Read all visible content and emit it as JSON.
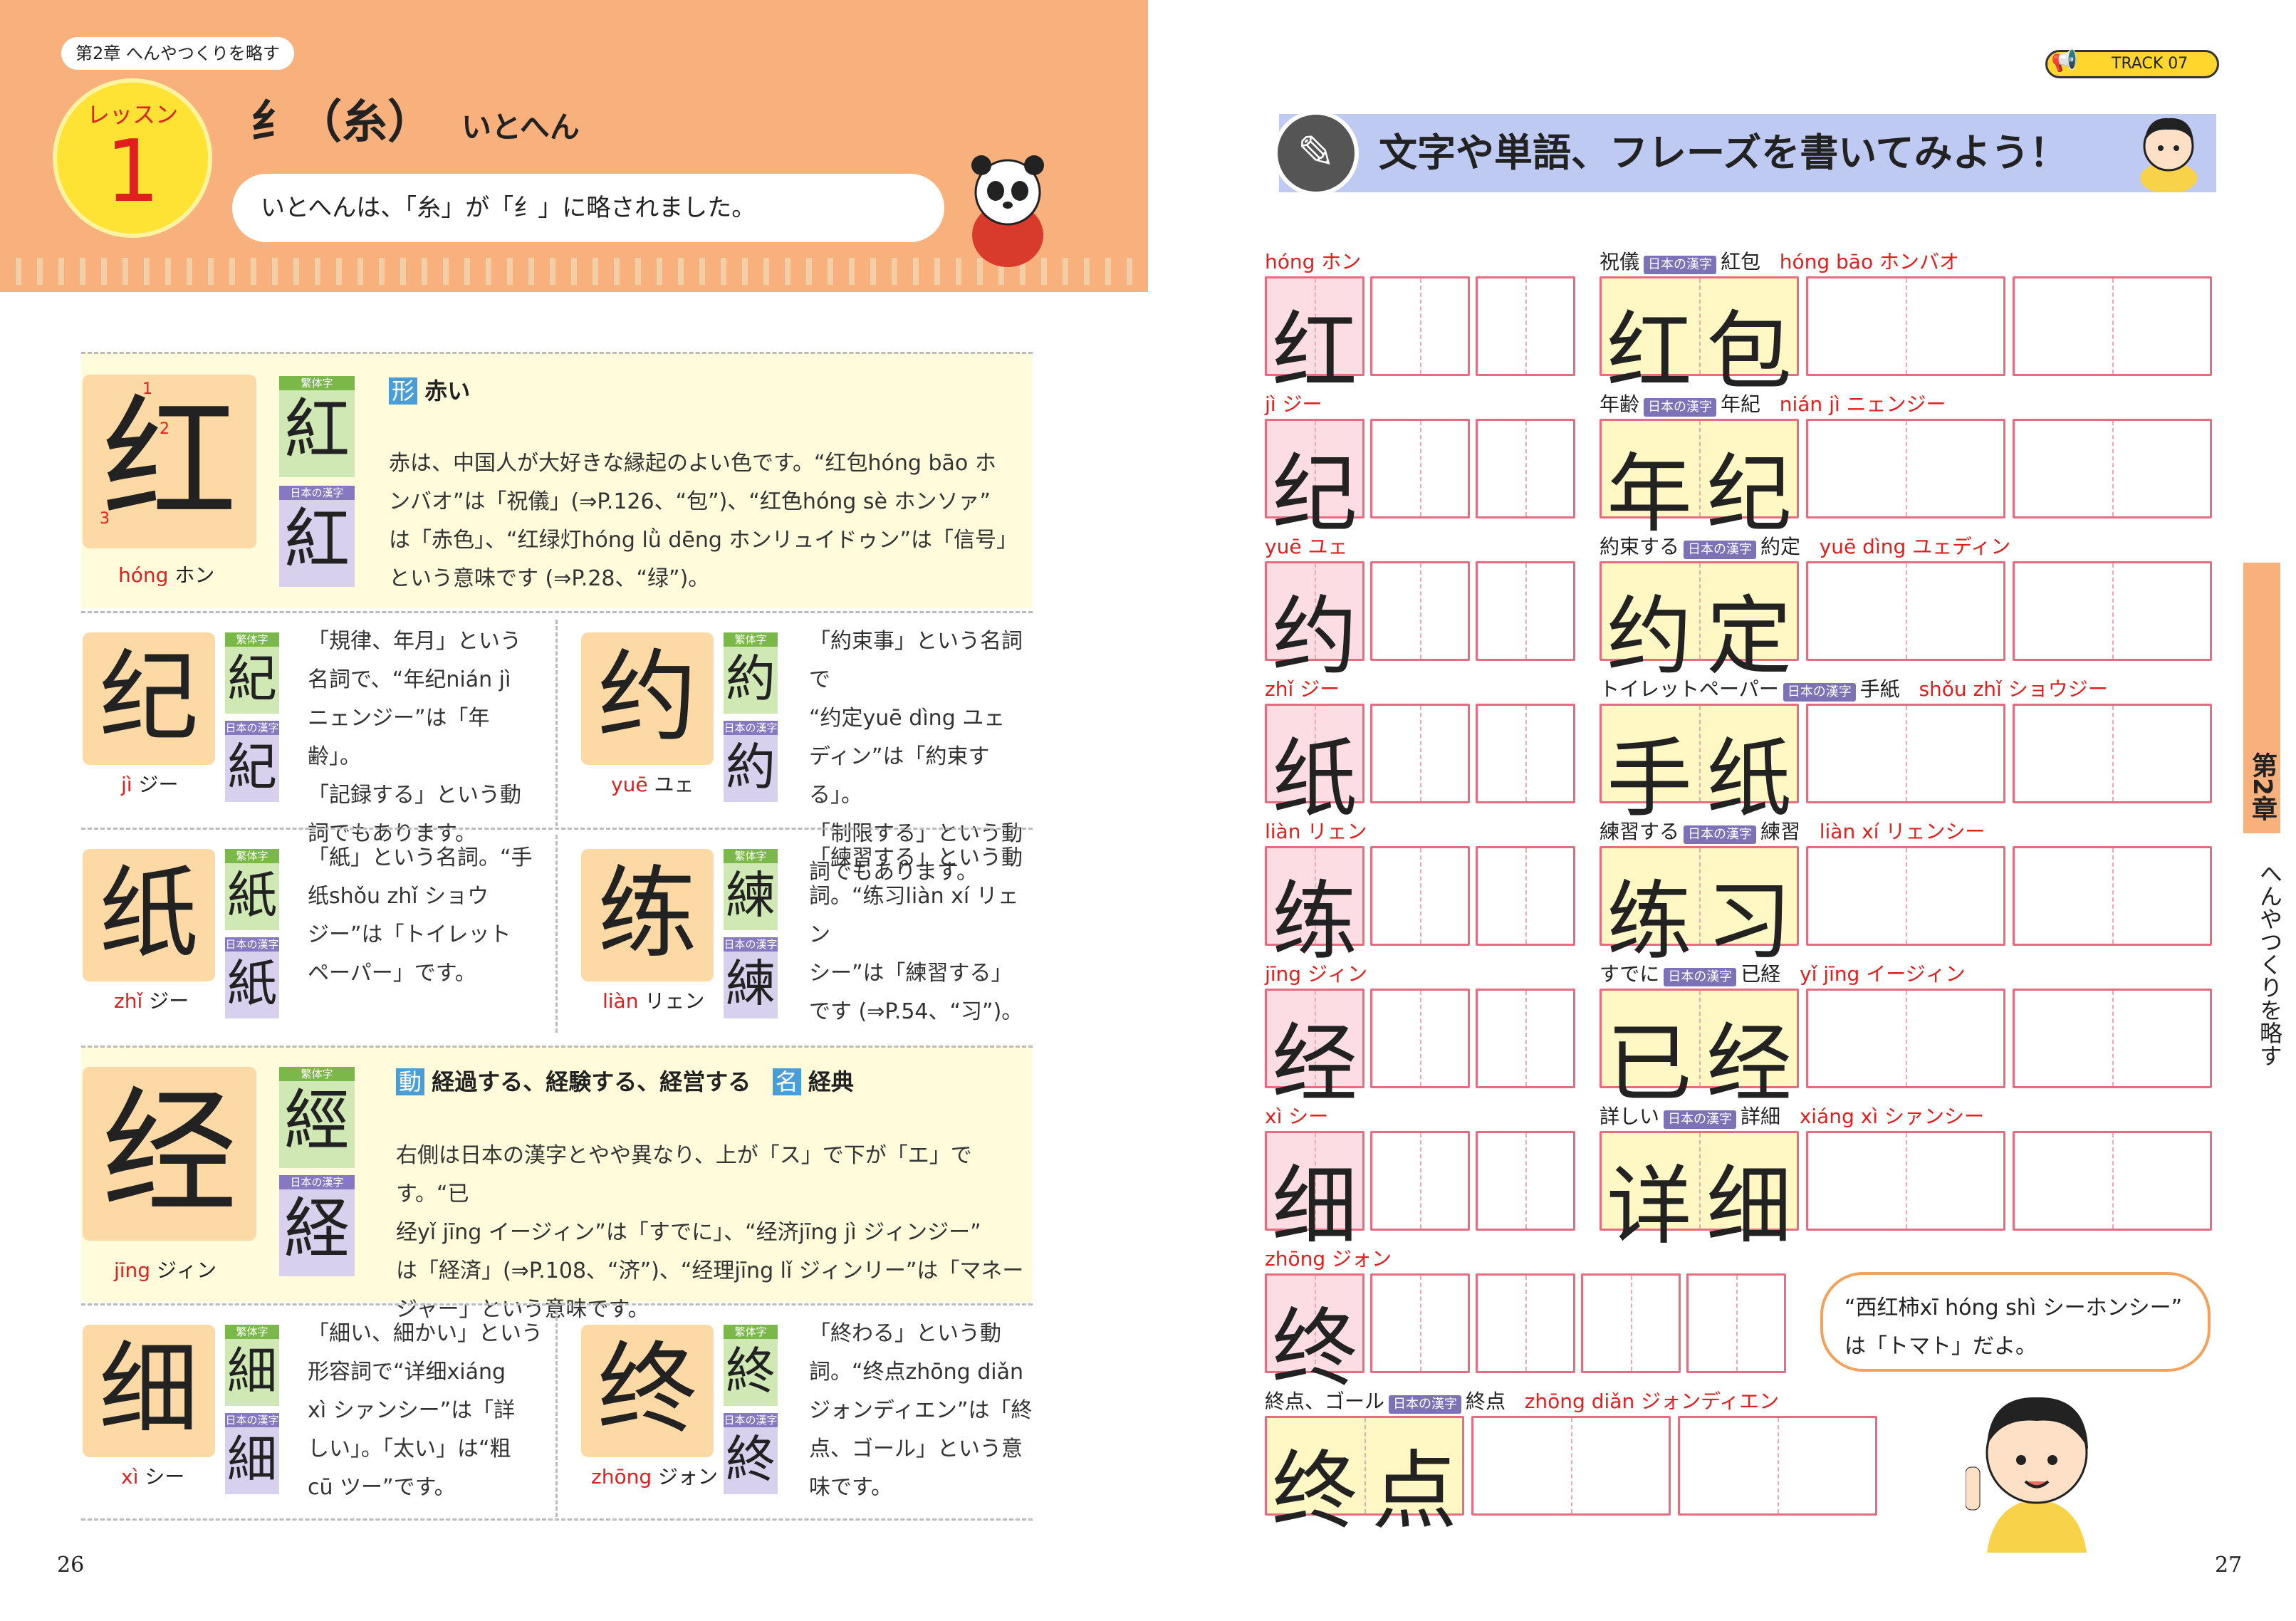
{
  "header": {
    "chapter_tag": "第2章 へんやつくりを略す",
    "lesson_label": "レッスン",
    "lesson_number": "1",
    "radical": "纟（糸）",
    "radical_name": "いとへん",
    "bubble": "いとへんは、「糸」が「纟」に略されました。"
  },
  "track": "TRACK 07",
  "banner": "文字や単語、フレーズを書いてみよう！",
  "mini_labels": {
    "trad": "繁体字",
    "jp": "日本の漢字"
  },
  "entries": [
    {
      "char": "红",
      "trad": "紅",
      "jp": "紅",
      "py": "hóng",
      "kana": "ホン",
      "meaning_tag": "形",
      "meaning": "赤い",
      "text": [
        "赤は、中国人が大好きな縁起のよい色です。“红包hóng bāo ホ",
        "ンバオ”は「祝儀」(⇒P.126、“包”)、“红色hóng sè ホンソァ”",
        "は「赤色」、“红绿灯hóng lǜ dēng ホンリュイドゥン”は「信号」",
        "という意味です (⇒P.28、“绿”)。"
      ]
    },
    {
      "char": "纪",
      "trad": "紀",
      "jp": "紀",
      "py": "jì",
      "kana": "ジー",
      "text": [
        "「規律、年月」という",
        "名詞で、“年纪nián jì",
        "ニェンジー”は「年齢」。",
        "「記録する」という動",
        "詞でもあります。"
      ]
    },
    {
      "char": "约",
      "trad": "約",
      "jp": "約",
      "py": "yuē",
      "kana": "ユェ",
      "text": [
        "「約束事」という名詞で",
        "“约定yuē dìng ユェ",
        "ディン”は「約束する」。",
        "「制限する」という動",
        "詞でもあります。"
      ]
    },
    {
      "char": "纸",
      "trad": "紙",
      "jp": "紙",
      "py": "zhǐ",
      "kana": "ジー",
      "text": [
        "「紙」という名詞。“手",
        "纸shǒu zhǐ ショウ",
        "ジー”は「トイレット",
        "ペーパー」です。"
      ]
    },
    {
      "char": "练",
      "trad": "練",
      "jp": "練",
      "py": "liàn",
      "kana": "リェン",
      "text": [
        "「練習する」という動",
        "詞。“练习liàn xí リェン",
        "シー”は「練習する」",
        "です (⇒P.54、“习”)。"
      ]
    },
    {
      "char": "经",
      "trad": "經",
      "jp": "経",
      "py": "jīng",
      "kana": "ジィン",
      "meaning_tag": "動",
      "meaning": "経過する、経験する、経営する",
      "meaning_tag2": "名",
      "meaning2": "経典",
      "text": [
        "右側は日本の漢字とやや異なり、上が「ス」で下が「エ」です。“已",
        "经yǐ jīng イージィン”は「すでに」、“经济jīng jì ジィンジー”",
        "は「経済」(⇒P.108、“济”)、“经理jīng lǐ ジィンリー”は「マネー",
        "ジャー」という意味です。"
      ]
    },
    {
      "char": "细",
      "trad": "細",
      "jp": "細",
      "py": "xì",
      "kana": "シー",
      "text": [
        "「細い、細かい」という",
        "形容詞で“详细xiáng",
        "xì シァンシー”は「詳",
        "しい」。「太い」は“粗",
        "cū ツー”です。"
      ]
    },
    {
      "char": "终",
      "trad": "終",
      "jp": "終",
      "py": "zhōng",
      "kana": "ジォン",
      "text": [
        "「終わる」という動",
        "詞。“终点zhōng diǎn",
        "ジォンディエン”は「終",
        "点、ゴール」という意",
        "味です。"
      ]
    }
  ],
  "practice": [
    {
      "ch": "红",
      "py": "hóng ホン",
      "word_jp": "祝儀",
      "kanji": "紅包",
      "word_py": "hóng bāo ホンバオ",
      "word": [
        "红",
        "包"
      ]
    },
    {
      "ch": "纪",
      "py": "jì ジー",
      "word_jp": "年齢",
      "kanji": "年紀",
      "word_py": "nián jì ニェンジー",
      "word": [
        "年",
        "纪"
      ]
    },
    {
      "ch": "约",
      "py": "yuē ユェ",
      "word_jp": "約束する",
      "kanji": "約定",
      "word_py": "yuē dìng ユェディン",
      "word": [
        "约",
        "定"
      ]
    },
    {
      "ch": "纸",
      "py": "zhǐ ジー",
      "word_jp": "トイレットペーパー",
      "kanji": "手紙",
      "word_py": "shǒu zhǐ ショウジー",
      "word": [
        "手",
        "纸"
      ]
    },
    {
      "ch": "练",
      "py": "liàn リェン",
      "word_jp": "練習する",
      "kanji": "練習",
      "word_py": "liàn xí リェンシー",
      "word": [
        "练",
        "习"
      ]
    },
    {
      "ch": "经",
      "py": "jīng ジィン",
      "word_jp": "すでに",
      "kanji": "已経",
      "word_py": "yǐ jīng イージィン",
      "word": [
        "已",
        "经"
      ]
    },
    {
      "ch": "细",
      "py": "xì シー",
      "word_jp": "詳しい",
      "kanji": "詳細",
      "word_py": "xiáng xì シァンシー",
      "word": [
        "详",
        "细"
      ]
    },
    {
      "ch": "终",
      "py": "zhōng ジォン"
    }
  ],
  "last_word": {
    "word_jp": "終点、ゴール",
    "kanji": "終点",
    "word_py": "zhōng diǎn ジォンディエン",
    "word": [
      "终",
      "点"
    ]
  },
  "speech": [
    "“西红柿xī hóng shì シーホンシー”",
    "は「トマト」だよ。"
  ],
  "side_tab": {
    "chapter": "第2章",
    "title": "へんやつくりを略す"
  },
  "page_left": "26",
  "page_right": "27"
}
